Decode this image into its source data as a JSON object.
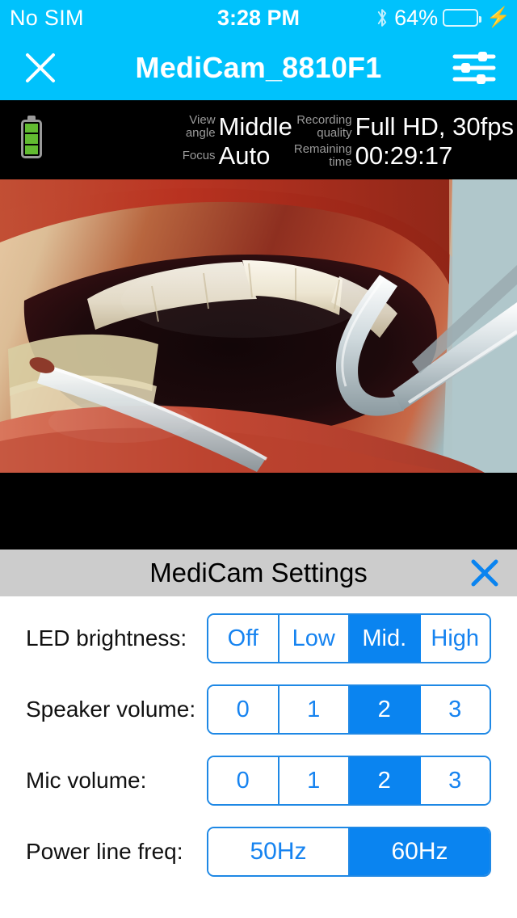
{
  "status_bar": {
    "carrier": "No SIM",
    "time": "3:28 PM",
    "bluetooth_icon": "bluetooth-icon",
    "battery_percent": "64%",
    "battery_level": 64,
    "charging_icon": "lightning-bolt-icon"
  },
  "nav": {
    "close_icon": "close-x-icon",
    "title": "MediCam_8810F1",
    "settings_icon": "sliders-icon"
  },
  "camera_info": {
    "battery_icon": "battery-icon",
    "items": [
      {
        "label": "View\nangle",
        "value": "Middle"
      },
      {
        "label": "Recording\nquality",
        "value": "Full HD, 30fps"
      },
      {
        "label": "Focus",
        "value": "Auto"
      },
      {
        "label": "Remaining\ntime",
        "value": "00:29:17"
      }
    ]
  },
  "video": {
    "name": "live-camera-feed"
  },
  "settings": {
    "title": "MediCam Settings",
    "close_icon": "close-x-icon",
    "accent_color": "#0A84F0",
    "rows": [
      {
        "label": "LED brightness:",
        "options": [
          "Off",
          "Low",
          "Mid.",
          "High"
        ],
        "selected": 2
      },
      {
        "label": "Speaker volume:",
        "options": [
          "0",
          "1",
          "2",
          "3"
        ],
        "selected": 2
      },
      {
        "label": "Mic volume:",
        "options": [
          "0",
          "1",
          "2",
          "3"
        ],
        "selected": 2
      },
      {
        "label": "Power line freq:",
        "options": [
          "50Hz",
          "60Hz"
        ],
        "selected": 1
      }
    ]
  },
  "colors": {
    "status_bar_bg": "#00C2FC",
    "sheet_header_bg": "#CCCCCC",
    "accent_blue": "#0A84F0",
    "battery_green": "#4CD964"
  }
}
